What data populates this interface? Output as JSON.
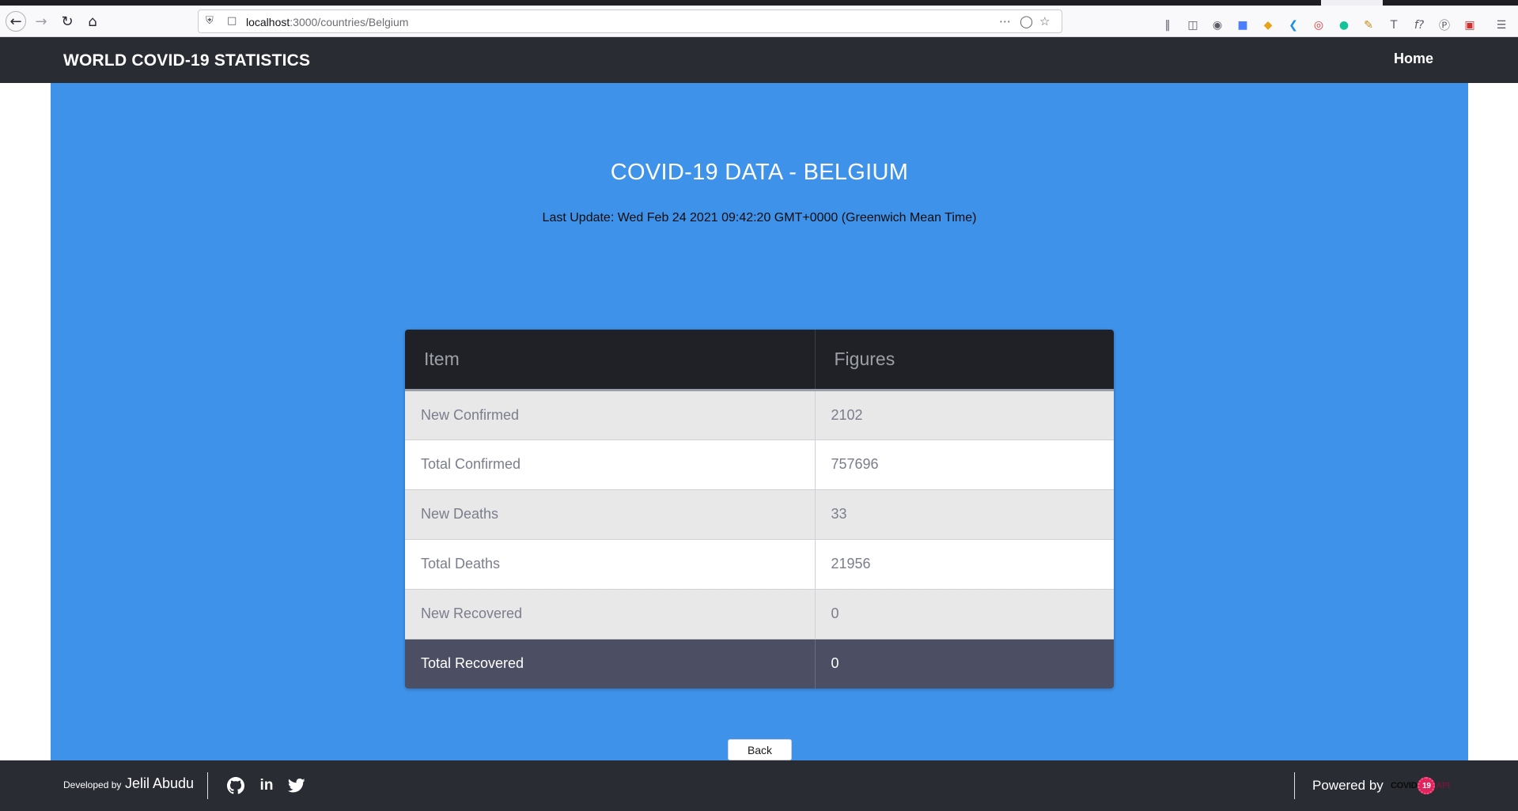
{
  "browser": {
    "url_host": "localhost",
    "url_rest": ":3000/countries/Belgium"
  },
  "nav": {
    "brand": "WORLD COVID-19 STATISTICS",
    "home": "Home"
  },
  "page": {
    "title": "COVID-19 DATA - BELGIUM",
    "last_update": "Last Update: Wed Feb 24 2021 09:42:20 GMT+0000 (Greenwich Mean Time)"
  },
  "table": {
    "headers": [
      "Item",
      "Figures"
    ],
    "rows": [
      {
        "item": "New Confirmed",
        "value": "2102"
      },
      {
        "item": "Total Confirmed",
        "value": "757696"
      },
      {
        "item": "New Deaths",
        "value": "33"
      },
      {
        "item": "Total Deaths",
        "value": "21956"
      },
      {
        "item": "New Recovered",
        "value": "0"
      },
      {
        "item": "Total Recovered",
        "value": "0"
      }
    ]
  },
  "back_button": "Back",
  "footer": {
    "developed_by": "Developed by",
    "developer": "Jelil Abudu",
    "powered_by": "Powered by",
    "api_logo_left": "COVID",
    "api_logo_badge": "19",
    "api_logo_right": "API"
  },
  "colors": {
    "navbar": "#292c33",
    "main_bg": "#3e92ea",
    "table_header": "#1f2127",
    "highlight_row": "#4c4f63"
  }
}
